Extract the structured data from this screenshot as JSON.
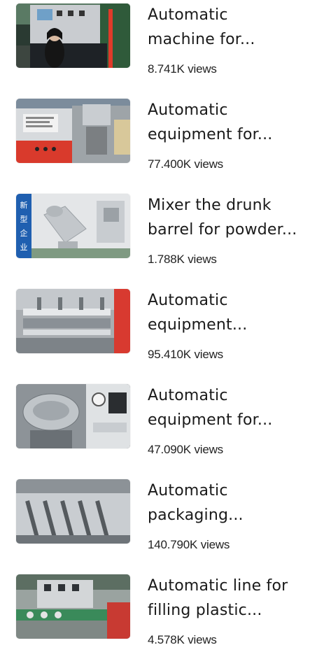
{
  "videos": [
    {
      "title_line1": "Automatic",
      "title_line2": "machine for...",
      "views": "8.741K views"
    },
    {
      "title_line1": "Automatic",
      "title_line2": "equipment for...",
      "views": "77.400K views"
    },
    {
      "title_line1": "Mixer the drunk",
      "title_line2": "barrel for powder...",
      "views": "1.788K views"
    },
    {
      "title_line1": "Automatic",
      "title_line2": "equipment...",
      "views": "95.410K views"
    },
    {
      "title_line1": "Automatic",
      "title_line2": "equipment for...",
      "views": "47.090K views"
    },
    {
      "title_line1": "Automatic",
      "title_line2": "packaging...",
      "views": "140.790K views"
    },
    {
      "title_line1": "Automatic line for",
      "title_line2": "filling plastic...",
      "views": "4.578K views"
    }
  ],
  "thumbnail_labels": {
    "banner_1": "新",
    "banner_2": "型",
    "banner_3": "企",
    "banner_4": "业"
  }
}
